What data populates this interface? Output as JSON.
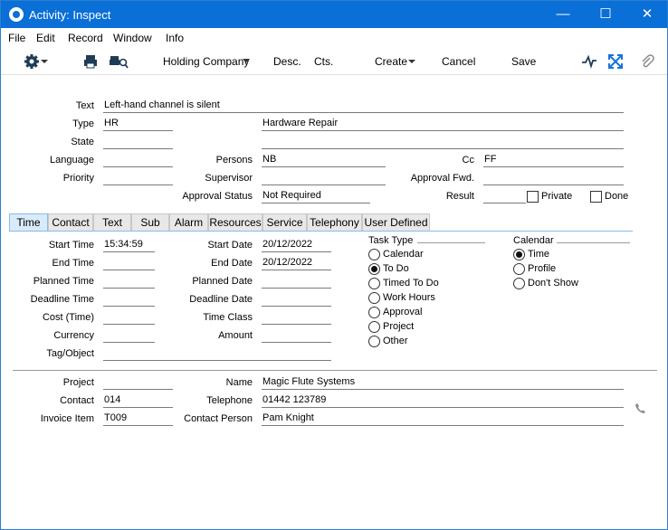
{
  "window": {
    "title": "Activity: Inspect",
    "minimize": "—",
    "maximize": "☐",
    "close": "✕"
  },
  "menu": [
    "File",
    "Edit",
    "Record",
    "Window",
    "Info"
  ],
  "toolbar": {
    "company": "Holding Company",
    "desc": "Desc.",
    "cts": "Cts.",
    "create": "Create",
    "cancel": "Cancel",
    "save": "Save"
  },
  "header": {
    "text_label": "Text",
    "text_value": "Left-hand channel is silent",
    "type_label": "Type",
    "type_value": "HR",
    "type_desc": "Hardware Repair",
    "state_label": "State",
    "state_value": "",
    "language_label": "Language",
    "language_value": "",
    "persons_label": "Persons",
    "persons_value": "NB",
    "cc_label": "Cc",
    "cc_value": "FF",
    "priority_label": "Priority",
    "priority_value": "",
    "supervisor_label": "Supervisor",
    "supervisor_value": "",
    "approval_fwd_label": "Approval Fwd.",
    "approval_fwd_value": "",
    "approval_status_label": "Approval Status",
    "approval_status_value": "Not Required",
    "result_label": "Result",
    "result_value": "",
    "private_label": "Private",
    "done_label": "Done"
  },
  "tabs": [
    "Time",
    "Contact",
    "Text",
    "Sub",
    "Alarm",
    "Resources",
    "Service",
    "Telephony",
    "User Defined"
  ],
  "time": {
    "start_time_label": "Start Time",
    "start_time": "15:34:59",
    "end_time_label": "End Time",
    "end_time": "",
    "planned_time_label": "Planned Time",
    "planned_time": "",
    "deadline_time_label": "Deadline Time",
    "deadline_time": "",
    "cost_time_label": "Cost (Time)",
    "cost_time": "",
    "currency_label": "Currency",
    "currency": "",
    "tag_object_label": "Tag/Object",
    "tag_object": "",
    "start_date_label": "Start Date",
    "start_date": "20/12/2022",
    "end_date_label": "End Date",
    "end_date": "20/12/2022",
    "planned_date_label": "Planned Date",
    "planned_date": "",
    "deadline_date_label": "Deadline Date",
    "deadline_date": "",
    "time_class_label": "Time Class",
    "time_class": "",
    "amount_label": "Amount",
    "amount": ""
  },
  "task_type": {
    "label": "Task Type",
    "options": [
      "Calendar",
      "To Do",
      "Timed To Do",
      "Work Hours",
      "Approval",
      "Project",
      "Other"
    ],
    "selected": "To Do"
  },
  "calendar": {
    "label": "Calendar",
    "options": [
      "Time",
      "Profile",
      "Don't Show"
    ],
    "selected": "Time"
  },
  "footer": {
    "project_label": "Project",
    "project": "",
    "contact_label": "Contact",
    "contact": "014",
    "invoice_item_label": "Invoice Item",
    "invoice_item": "T009",
    "name_label": "Name",
    "name": "Magic Flute Systems",
    "telephone_label": "Telephone",
    "telephone": "01442 123789",
    "contact_person_label": "Contact Person",
    "contact_person": "Pam Knight"
  }
}
